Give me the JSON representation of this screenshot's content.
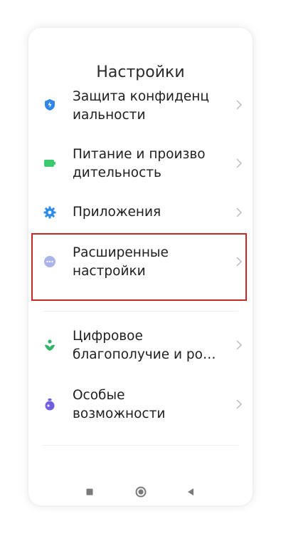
{
  "header": {
    "title": "Настройки"
  },
  "items": [
    {
      "label": "Защита конфиденц\nиальности",
      "icon": "shield-icon",
      "color": "#2f86e8"
    },
    {
      "label": "Питание и произво\nдительность",
      "icon": "battery-icon",
      "color": "#3bcb6e"
    },
    {
      "label": "Приложения",
      "icon": "gear-icon",
      "color": "#2f8de8"
    },
    {
      "label": "Расширенные\nнастройки",
      "icon": "more-dots-icon",
      "color": "#9aa6e8"
    },
    {
      "label": "Цифровое\nблагополучие и ро…",
      "icon": "wellbeing-icon",
      "color": "#33b36a"
    },
    {
      "label": "Особые\nвозможности",
      "icon": "accessibility-icon",
      "color": "#6f5ee0"
    }
  ],
  "navbar": {
    "buttons": [
      "recents-square-icon",
      "home-circle-icon",
      "back-triangle-icon"
    ]
  },
  "highlight_color": "#c62828"
}
